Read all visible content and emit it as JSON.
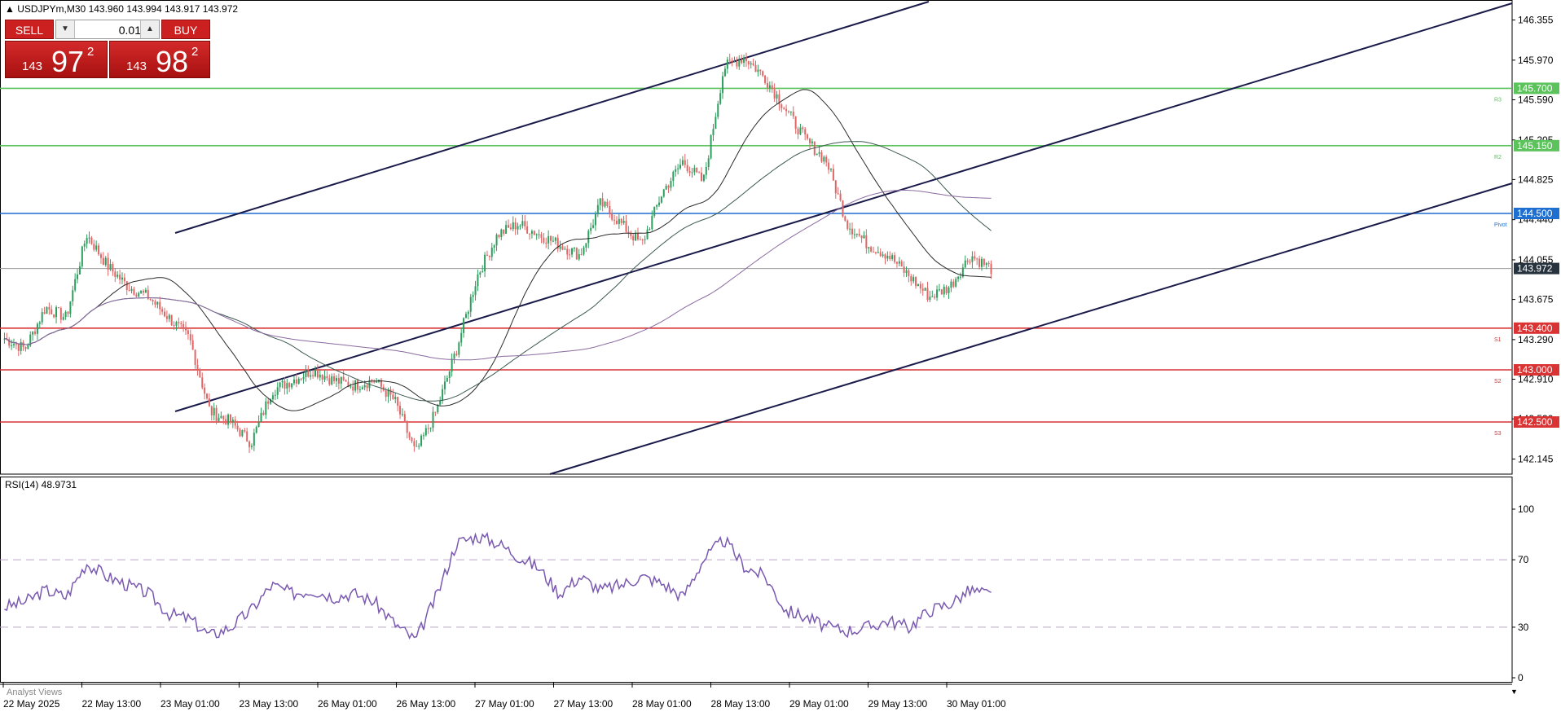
{
  "header": {
    "symbol_line": "▲ USDJPYm,M30  143.960 143.994 143.917 143.972"
  },
  "trade_panel": {
    "sell_label": "SELL",
    "buy_label": "BUY",
    "lot": "0.01",
    "sell_price": {
      "small": "143",
      "big": "97",
      "sup": "2"
    },
    "buy_price": {
      "small": "143",
      "big": "98",
      "sup": "2"
    }
  },
  "price_axis": {
    "ticks": [
      "146.355",
      "145.970",
      "145.590",
      "145.205",
      "144.825",
      "144.440",
      "144.055",
      "143.675",
      "143.290",
      "142.910",
      "142.530",
      "142.145"
    ]
  },
  "levels": [
    {
      "value": 145.7,
      "label": "145.700",
      "tag": "R3",
      "color": "#5cc25c"
    },
    {
      "value": 145.15,
      "label": "145.150",
      "tag": "R2",
      "color": "#5cc25c"
    },
    {
      "value": 144.5,
      "label": "144.500",
      "tag": "Pivot",
      "color": "#1f6fd1"
    },
    {
      "value": 143.4,
      "label": "143.400",
      "tag": "S1",
      "color": "#d93333"
    },
    {
      "value": 143.0,
      "label": "143.000",
      "tag": "S2",
      "color": "#d93333"
    },
    {
      "value": 142.5,
      "label": "142.500",
      "tag": "S3",
      "color": "#d93333"
    }
  ],
  "current_price": "143.972",
  "rsi": {
    "title": "RSI(14) 48.9731",
    "ticks": [
      "100",
      "70",
      "30",
      "0"
    ]
  },
  "time_axis": {
    "labels": [
      "22 May 2025",
      "22 May 13:00",
      "23 May 01:00",
      "23 May 13:00",
      "26 May 01:00",
      "26 May 13:00",
      "27 May 01:00",
      "27 May 13:00",
      "28 May 01:00",
      "28 May 13:00",
      "29 May 01:00",
      "29 May 13:00",
      "30 May 01:00"
    ]
  },
  "footer": {
    "analyst_label": "Analyst Views"
  },
  "colors": {
    "bull": "#2e9e5e",
    "bear": "#e06666",
    "rsi": "#7a5ab0"
  },
  "chart_data": {
    "type": "candlestick",
    "close_path": [
      143.3,
      143.2,
      143.6,
      143.5,
      144.3,
      144.0,
      143.8,
      143.7,
      143.5,
      143.3,
      142.6,
      142.5,
      142.3,
      142.8,
      142.9,
      143.0,
      142.9,
      142.85,
      142.9,
      142.7,
      142.2,
      142.6,
      143.2,
      143.9,
      144.3,
      144.4,
      144.3,
      144.2,
      144.1,
      144.6,
      144.4,
      144.2,
      144.7,
      145.0,
      144.8,
      145.9,
      146.0,
      145.8,
      145.5,
      145.2,
      145.0,
      144.4,
      144.2,
      144.1,
      143.9,
      143.7,
      143.8,
      144.1,
      143.97
    ],
    "rsi_path": [
      42,
      45,
      52,
      48,
      68,
      60,
      55,
      50,
      38,
      35,
      25,
      30,
      40,
      55,
      50,
      52,
      48,
      50,
      45,
      32,
      22,
      48,
      80,
      84,
      80,
      72,
      65,
      50,
      60,
      52,
      55,
      60,
      56,
      48,
      70,
      82,
      66,
      60,
      40,
      36,
      30,
      28,
      30,
      34,
      30,
      40,
      44,
      52,
      49
    ]
  }
}
